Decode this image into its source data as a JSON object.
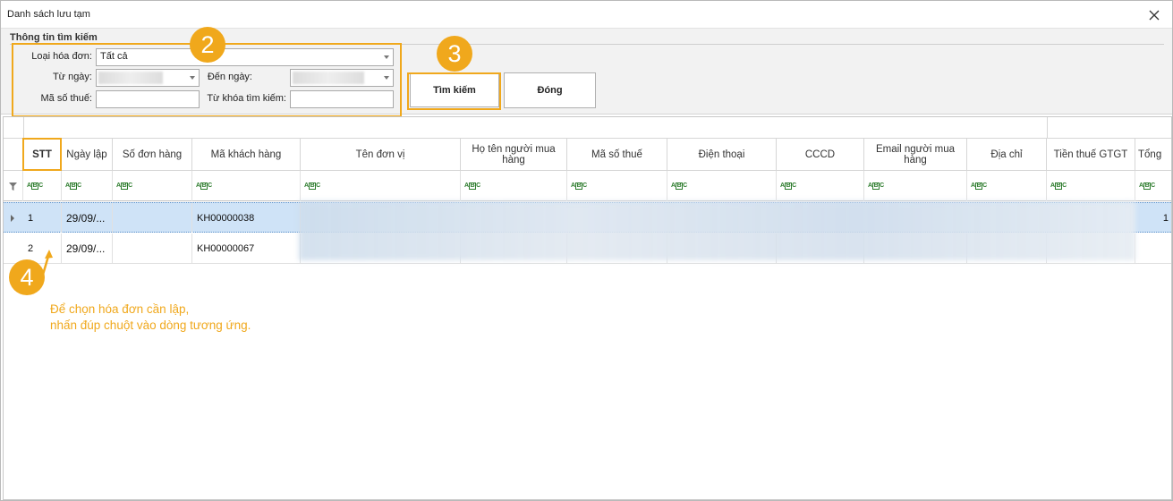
{
  "window": {
    "title": "Danh sách lưu tạm"
  },
  "search": {
    "section_title": "Thông tin tìm kiếm",
    "invoice_type_label": "Loại hóa đơn:",
    "invoice_type_value": "Tất cả",
    "from_date_label": "Từ ngày:",
    "to_date_label": "Đến ngày:",
    "tax_code_label": "Mã số thuế:",
    "tax_code_value": "",
    "keyword_label": "Từ khóa tìm kiếm:",
    "keyword_value": ""
  },
  "buttons": {
    "search_label": "Tìm kiếm",
    "close_label": "Đóng"
  },
  "annotations": {
    "badge2": "2",
    "badge3": "3",
    "badge4": "4",
    "note_line1": "Để chọn hóa đơn cần lập,",
    "note_line2": "nhấn đúp chuột vào dòng tương ứng.",
    "accent_color": "#f0a81c"
  },
  "grid": {
    "columns": [
      "STT",
      "Ngày lập",
      "Số đơn hàng",
      "Mã khách hàng",
      "Tên đơn vị",
      "Họ tên người mua hàng",
      "Mã số thuế",
      "Điện thoại",
      "CCCD",
      "Email người mua hàng",
      "Địa chỉ",
      "Tiền thuế GTGT",
      "Tổng"
    ],
    "filter_icon": "filter-icon",
    "rows": [
      {
        "stt": "1",
        "date": "29/09/...",
        "order_no": "",
        "customer_code": "KH00000038",
        "extra": "1"
      },
      {
        "stt": "2",
        "date": "29/09/...",
        "order_no": "",
        "customer_code": "KH00000067"
      }
    ]
  }
}
